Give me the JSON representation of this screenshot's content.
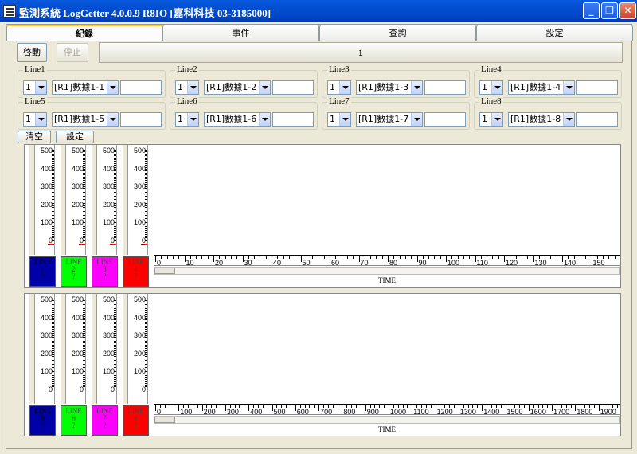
{
  "window": {
    "title": "監測系統 LogGetter 4.0.0.9 R8IO  [嘉科科技 03-3185000]"
  },
  "tabs": [
    {
      "label": "紀錄"
    },
    {
      "label": "事件"
    },
    {
      "label": "查詢"
    },
    {
      "label": "設定"
    }
  ],
  "toolbar": {
    "start_label": "啓動",
    "stop_label": "停止",
    "banner_value": "1"
  },
  "lines": [
    {
      "label": "Line1",
      "num": "1",
      "source": "[R1]數據1-1"
    },
    {
      "label": "Line2",
      "num": "1",
      "source": "[R1]數據1-2"
    },
    {
      "label": "Line3",
      "num": "1",
      "source": "[R1]數據1-3"
    },
    {
      "label": "Line4",
      "num": "1",
      "source": "[R1]數據1-4"
    },
    {
      "label": "Line5",
      "num": "1",
      "source": "[R1]數據1-5"
    },
    {
      "label": "Line6",
      "num": "1",
      "source": "[R1]數據1-6"
    },
    {
      "label": "Line7",
      "num": "1",
      "source": "[R1]數據1-7"
    },
    {
      "label": "Line8",
      "num": "1",
      "source": "[R1]數據1-8"
    }
  ],
  "chart_controls": {
    "clear_label": "清空",
    "settings_label": "設定"
  },
  "charts": [
    {
      "gauge_ticks": [
        "500",
        "400",
        "300",
        "200",
        "100",
        "0"
      ],
      "legends": [
        {
          "l1": "LINE",
          "l2": "1",
          "l3": "?",
          "color": "#0000a8"
        },
        {
          "l1": "LINE",
          "l2": "2",
          "l3": "?",
          "color": "#00ff00"
        },
        {
          "l1": "LINE",
          "l2": "3",
          "l3": "?",
          "color": "#ff00ff"
        },
        {
          "l1": "LINE",
          "l2": "4",
          "l3": "?",
          "color": "#ff0000"
        }
      ],
      "x_ticks": [
        "0",
        "10",
        "20",
        "30",
        "40",
        "50",
        "60",
        "70",
        "80",
        "90",
        "100",
        "110",
        "120",
        "130",
        "140",
        "150"
      ],
      "x_label": "TIME"
    },
    {
      "gauge_ticks": [
        "500",
        "400",
        "300",
        "200",
        "100",
        "0"
      ],
      "legends": [
        {
          "l1": "LINE",
          "l2": "5",
          "l3": "?",
          "color": "#0000a8"
        },
        {
          "l1": "LINE",
          "l2": "6",
          "l3": "?",
          "color": "#00ff00"
        },
        {
          "l1": "LINE",
          "l2": "7",
          "l3": "?",
          "color": "#ff00ff"
        },
        {
          "l1": "LINE",
          "l2": "8",
          "l3": "?",
          "color": "#ff0000"
        }
      ],
      "x_ticks": [
        "0",
        "100",
        "200",
        "300",
        "400",
        "500",
        "600",
        "700",
        "800",
        "900",
        "1000",
        "1100",
        "1200",
        "1300",
        "1400",
        "1500",
        "1600",
        "1700",
        "1800",
        "1900"
      ],
      "x_label": "TIME"
    }
  ]
}
